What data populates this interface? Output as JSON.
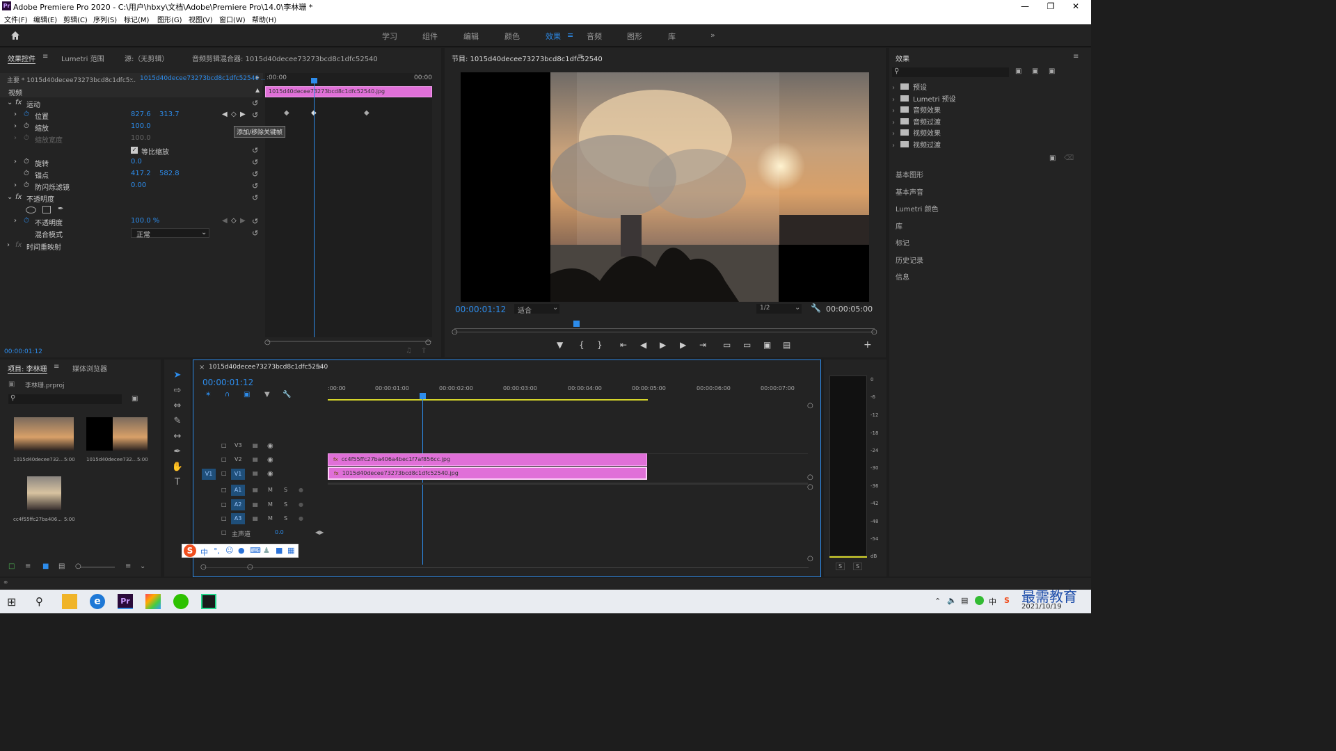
{
  "window": {
    "title": "Adobe Premiere Pro 2020 - C:\\用户\\hbxy\\文档\\Adobe\\Premiere Pro\\14.0\\李林珊 *",
    "logo": "Pr"
  },
  "menu": [
    "文件(F)",
    "编辑(E)",
    "剪辑(C)",
    "序列(S)",
    "标记(M)",
    "图形(G)",
    "视图(V)",
    "窗口(W)",
    "帮助(H)"
  ],
  "workspaces": [
    "学习",
    "组件",
    "编辑",
    "颜色",
    "效果",
    "音频",
    "图形",
    "库"
  ],
  "active_workspace": "效果",
  "effect_controls": {
    "tabs": [
      "效果控件",
      "Lumetri 范围",
      "源:（无剪辑）",
      "音频剪辑混合器: 1015d40decee73273bcd8c1dfc52540"
    ],
    "master": "主要 * 1015d40decee73273bcd8c1dfc5...",
    "clip": "1015d40decee73273bcd8c1dfc52540 ...",
    "section_video": "视频",
    "motion": "运动",
    "position_label": "位置",
    "position_x": "827.6",
    "position_y": "313.7",
    "scale_label": "缩放",
    "scale_val": "100.0",
    "scale_w_label": "缩放宽度",
    "scale_w_val": "100.0",
    "uniform_label": "等比缩放",
    "rotation_label": "旋转",
    "rotation_val": "0.0",
    "anchor_label": "锚点",
    "anchor_x": "417.2",
    "anchor_y": "582.8",
    "flicker_label": "防闪烁滤镜",
    "flicker_val": "0.00",
    "opacity": "不透明度",
    "opacity_label": "不透明度",
    "opacity_val": "100.0 %",
    "blend_label": "混合模式",
    "blend_val": "正常",
    "time_remap": "时间重映射",
    "tooltip": "添加/移除关键帧",
    "tl_start": ":00:00",
    "tl_end": "00:00",
    "tl_clip": "1015d40decee73273bcd8c1dfc52540.jpg",
    "timecode": "00:00:01:12"
  },
  "program": {
    "title": "节目: 1015d40decee73273bcd8c1dfc52540",
    "timecode": "00:00:01:12",
    "fit": "适合",
    "res": "1/2",
    "duration": "00:00:05:00"
  },
  "effects_panel": {
    "title": "效果",
    "tree": [
      "预设",
      "Lumetri 预设",
      "音频效果",
      "音频过渡",
      "视频效果",
      "视频过渡"
    ],
    "sections": [
      "基本图形",
      "基本声音",
      "Lumetri 颜色",
      "库",
      "标记",
      "历史记录",
      "信息"
    ]
  },
  "project": {
    "tabs": [
      "项目: 李林珊",
      "媒体浏览器"
    ],
    "file": "李林珊.prproj",
    "items": [
      {
        "name": "1015d40decee732...",
        "dur": "5:00"
      },
      {
        "name": "1015d40decee732...",
        "dur": "5:00"
      },
      {
        "name": "cc4f55ffc27ba406...",
        "dur": "5:00"
      }
    ]
  },
  "timeline": {
    "title": "1015d40decee73273bcd8c1dfc52540",
    "timecode": "00:00:01:12",
    "ruler": [
      ":00:00",
      "00:00:01:00",
      "00:00:02:00",
      "00:00:03:00",
      "00:00:04:00",
      "00:00:05:00",
      "00:00:06:00",
      "00:00:07:00"
    ],
    "video_tracks": [
      "V3",
      "V2",
      "V1"
    ],
    "audio_tracks": [
      "A1",
      "A2",
      "A3"
    ],
    "source_v": "V1",
    "master": "主声道",
    "master_val": "0.0",
    "clip_v2": "cc4f55ffc27ba406a4bec1f7af856cc.jpg",
    "clip_v1": "1015d40decee73273bcd8c1dfc52540.jpg",
    "m": "M",
    "s": "S"
  },
  "meter": {
    "scale": [
      "0",
      "-6",
      "-12",
      "-18",
      "-24",
      "-30",
      "-36",
      "-42",
      "-48",
      "-54",
      "dB"
    ],
    "s": "S"
  },
  "ime": {
    "logo": "S",
    "mode": "中"
  },
  "tray": {
    "date": "2021/10/19",
    "watermark": "最需教育",
    "lang": "中",
    "ime_s": "S"
  },
  "colors": {
    "accent": "#2d8ceb",
    "clip": "#e070d8"
  }
}
